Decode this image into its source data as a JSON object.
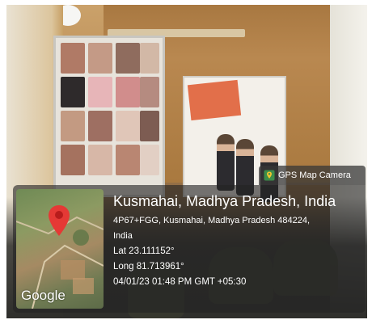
{
  "gps_tag": {
    "label": "GPS Map Camera",
    "icon": "map-pin-icon"
  },
  "map": {
    "provider": "Google",
    "pin_color": "#e53935"
  },
  "location": {
    "title": "Kusmahai, Madhya Pradesh, India",
    "address_line1": "4P67+FGG, Kusmahai, Madhya Pradesh 484224,",
    "address_line2": "India",
    "lat": "Lat 23.111152°",
    "long": "Long 81.713961°",
    "datetime": "04/01/23 01:48 PM GMT +05:30"
  }
}
